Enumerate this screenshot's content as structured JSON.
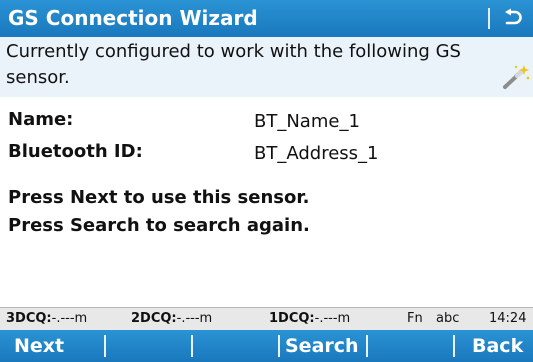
{
  "header": {
    "title": "GS Connection Wizard"
  },
  "info": {
    "message": "Currently configured to work with the following GS sensor."
  },
  "fields": {
    "name_label": "Name:",
    "name_value": "BT_Name_1",
    "bluetooth_label": "Bluetooth ID:",
    "bluetooth_value": "BT_Address_1"
  },
  "instructions": {
    "line1": "Press Next to use this sensor.",
    "line2": "Press Search to search again."
  },
  "status": {
    "q3_label": "3DCQ:",
    "q3_value": "-.---m",
    "q2_label": "2DCQ:",
    "q2_value": "-.---m",
    "q1_label": "1DCQ:",
    "q1_value": "-.---m",
    "fn": "Fn",
    "input_mode": "abc",
    "time": "14:24"
  },
  "softkeys": {
    "next": "Next",
    "search": "Search",
    "back": "Back"
  },
  "colors": {
    "title_bar": "#1f86c8",
    "info_band": "#eaf3fa",
    "status_bar": "#e8e8e8"
  },
  "icons": {
    "back": "return-arrow-icon",
    "wizard": "magic-wand-icon"
  }
}
